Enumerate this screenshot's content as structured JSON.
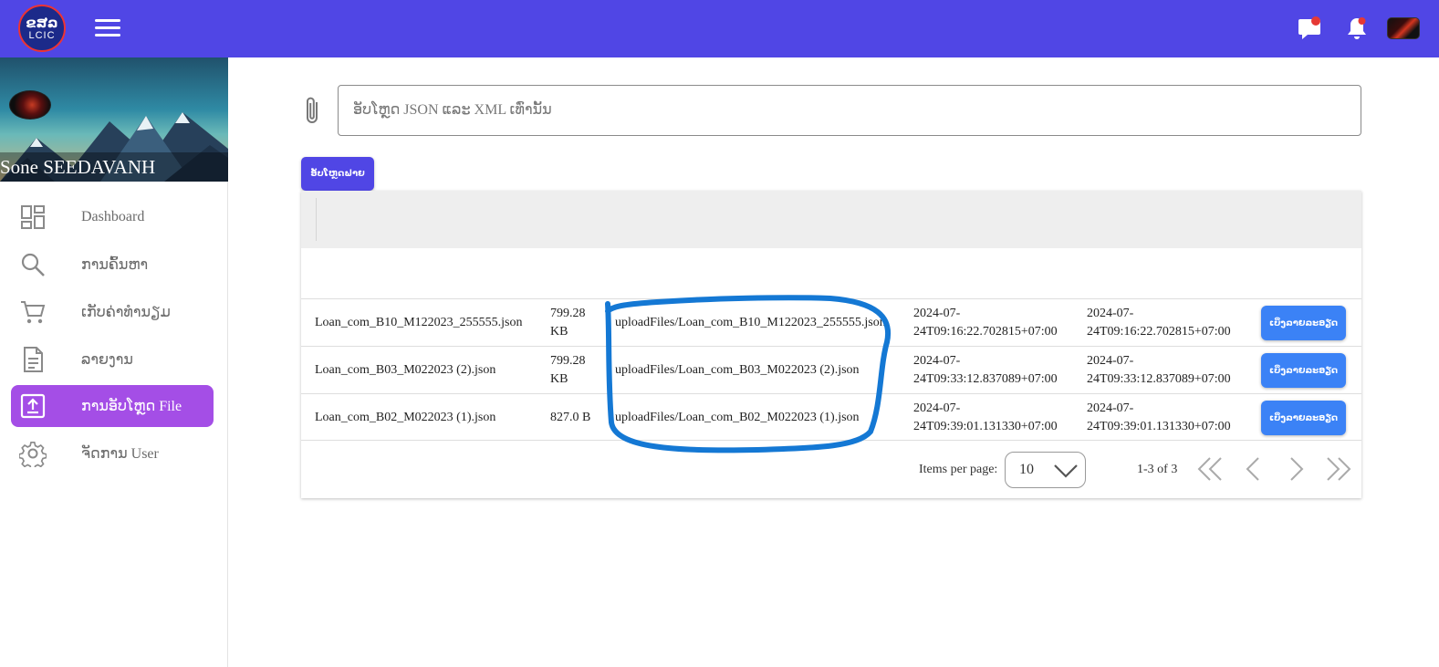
{
  "header": {
    "logo_text_lao": "ຂສລ",
    "logo_text_latin": "LCIC",
    "icons": [
      "menu-icon",
      "chat-icon",
      "bell-icon",
      "avatar"
    ],
    "brand_color": "#5046e5"
  },
  "sidebar": {
    "user_name": "Sone SEEDAVANH",
    "items": [
      {
        "label": "Dashboard",
        "icon": "dashboard-icon",
        "active": false
      },
      {
        "label": "ການຄົ້ນຫາ",
        "icon": "search-icon",
        "active": false
      },
      {
        "label": "ເກັບຄ່າທຳນຽມ",
        "icon": "cart-icon",
        "active": false
      },
      {
        "label": "ລາຍງານ",
        "icon": "document-icon",
        "active": false
      },
      {
        "label": "ການອັບໂຫຼດ File",
        "icon": "upload-icon",
        "active": true
      },
      {
        "label": "ຈັດການ User",
        "icon": "gear-icon",
        "active": false
      }
    ],
    "active_color": "#a44ee6"
  },
  "upload": {
    "placeholder": "ອັບໂຫຼດ JSON ແລະ XML ເທົ່ານັ້ນ",
    "value": "",
    "button_label": "ອັບໂຫຼດຟາຍ"
  },
  "table": {
    "rows": [
      {
        "file_name": "Loan_com_B10_M122023_255555.json",
        "size": "799.28 KB",
        "path": "uploadFiles/Loan_com_B10_M122023_255555.json",
        "created": "2024-07-24T09:16:22.702815+07:00",
        "updated": "2024-07-24T09:16:22.702815+07:00",
        "action": "ເບິ່ງລາຍລະອຽດ"
      },
      {
        "file_name": "Loan_com_B03_M022023 (2).json",
        "size": "799.28 KB",
        "path": "uploadFiles/Loan_com_B03_M022023 (2).json",
        "created": "2024-07-24T09:33:12.837089+07:00",
        "updated": "2024-07-24T09:33:12.837089+07:00",
        "action": "ເບິ່ງລາຍລະອຽດ"
      },
      {
        "file_name": "Loan_com_B02_M022023 (1).json",
        "size": "827.0 B",
        "path": "uploadFiles/Loan_com_B02_M022023 (1).json",
        "created": "2024-07-24T09:39:01.131330+07:00",
        "updated": "2024-07-24T09:39:01.131330+07:00",
        "action": "ເບິ່ງລາຍລະອຽດ"
      }
    ]
  },
  "paginator": {
    "items_per_page_label": "Items per page:",
    "items_per_page_value": "10",
    "range_label": "1-3 of 3"
  },
  "annotation": {
    "color": "#1478d4"
  }
}
